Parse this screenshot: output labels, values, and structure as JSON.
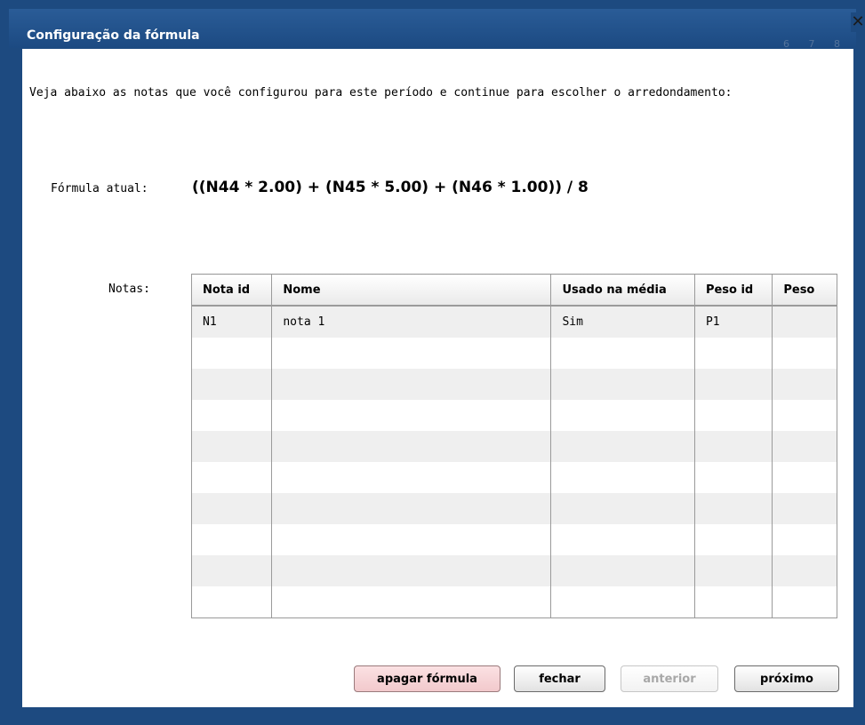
{
  "dialog": {
    "title": "Configuração da fórmula",
    "background_numbers": [
      "6",
      "7",
      "8"
    ]
  },
  "intro_text": "Veja abaixo as notas que você configurou para este período e continue para escolher o arredondamento:",
  "formula": {
    "label": "Fórmula atual:",
    "value": "((N44 * 2.00) + (N45 * 5.00) + (N46 * 1.00)) / 8"
  },
  "notes": {
    "label": "Notas:",
    "columns": [
      "Nota id",
      "Nome",
      "Usado na média",
      "Peso id",
      "Peso"
    ],
    "rows": [
      [
        "N1",
        "nota 1",
        "Sim",
        "P1",
        ""
      ]
    ]
  },
  "buttons": {
    "delete": "apagar fórmula",
    "close": "fechar",
    "previous": "anterior",
    "next": "próximo"
  }
}
